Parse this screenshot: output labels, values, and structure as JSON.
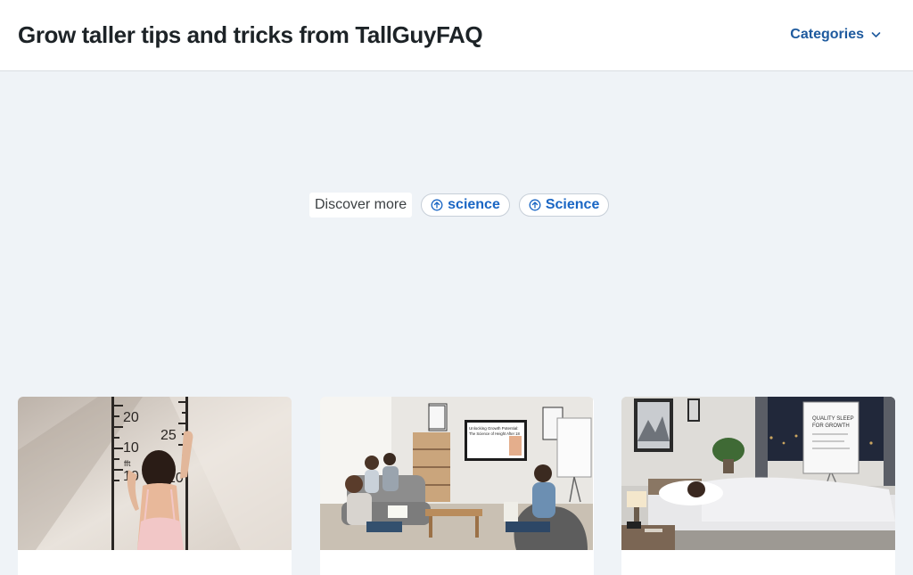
{
  "header": {
    "site_title": "Grow taller tips and tricks from TallGuyFAQ",
    "categories_label": "Categories"
  },
  "discover": {
    "label": "Discover more",
    "chips": [
      {
        "label": "science"
      },
      {
        "label": "Science"
      }
    ]
  },
  "cards": [
    {
      "image_label": "girl-measuring-height-chart",
      "ruler_marks": [
        "20",
        "10",
        "fft",
        "10",
        "25",
        "10"
      ]
    },
    {
      "image_label": "group-study-session-tv-presentation",
      "tv_text": [
        "Unlocking Growth Potential:",
        "The Science of Height After 18"
      ]
    },
    {
      "image_label": "person-sleeping-quality-sleep-whiteboard",
      "board_text": [
        "QUALITY SLEEP",
        "FOR GROWTH"
      ]
    }
  ],
  "colors": {
    "header_bg": "#ffffff",
    "page_bg": "#eff3f7",
    "title": "#1d2327",
    "link": "#1e5a9e",
    "chip_text": "#1a66c4"
  }
}
